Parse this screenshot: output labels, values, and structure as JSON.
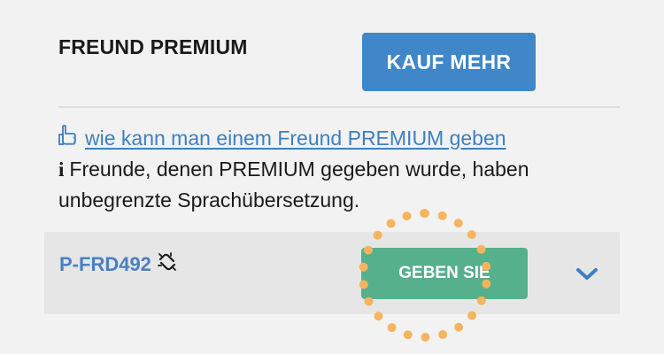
{
  "section": {
    "title": "FREUND PREMIUM",
    "buy_more_label": "KAUF MEHR"
  },
  "help": {
    "how_to_link": "wie kann man einem Freund PREMIUM geben",
    "info_text": "Freunde, denen PREMIUM gegeben wurde, haben unbegrenzte Sprachübersetzung."
  },
  "gift_row": {
    "code": "P-FRD492",
    "give_label": "GEBEN SIE"
  },
  "icons": {
    "how_to": "thumbs-up-icon",
    "info": "info-icon",
    "unlink": "broken-link-icon",
    "expand": "chevron-down-icon"
  },
  "colors": {
    "primary_blue": "#3f87c8",
    "give_green": "#56b08c",
    "highlight_orange": "#f7b45f",
    "link_blue": "#3f7fbf"
  }
}
